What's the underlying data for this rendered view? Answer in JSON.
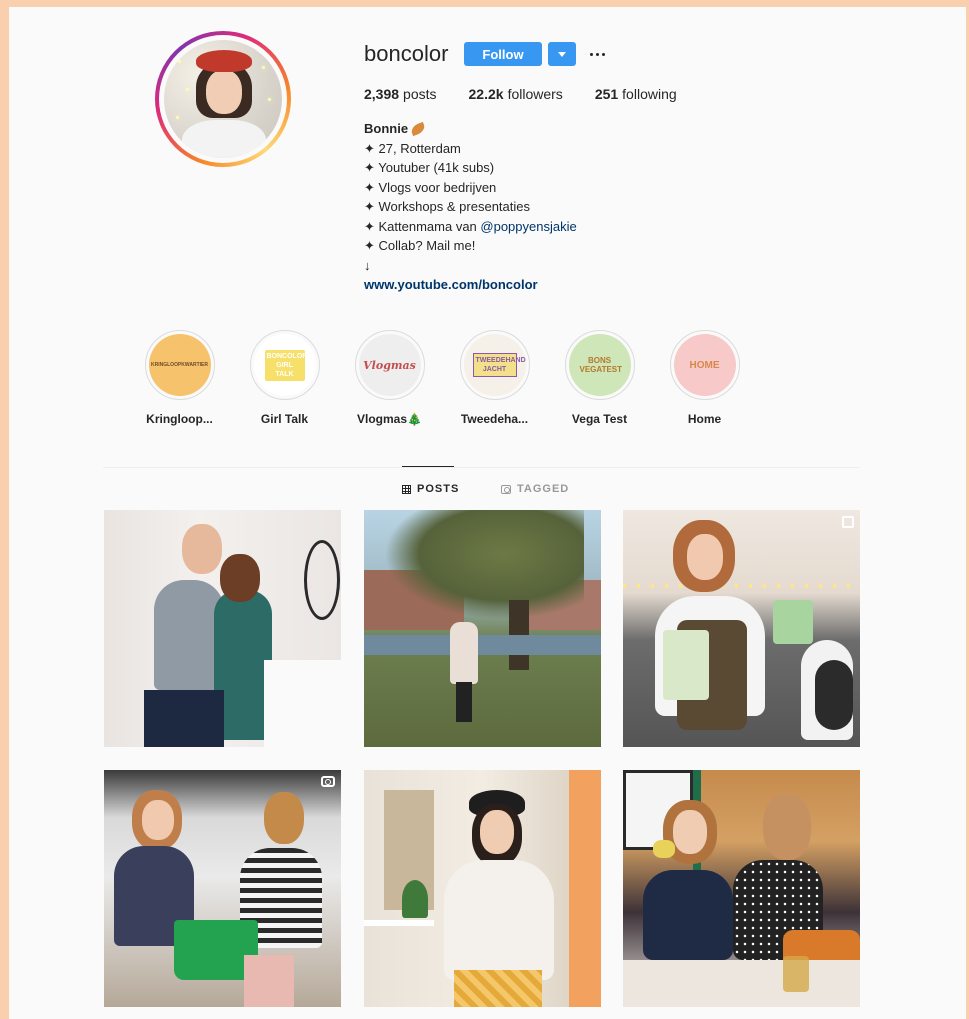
{
  "profile": {
    "username": "boncolor",
    "follow_label": "Follow",
    "stats": {
      "posts_count": "2,398",
      "posts_label": "posts",
      "followers_count": "22.2k",
      "followers_label": "followers",
      "following_count": "251",
      "following_label": "following"
    },
    "bio": {
      "name": "Bonnie",
      "lines": [
        "✦ 27, Rotterdam",
        "✦ Youtuber (41k subs)",
        "✦ Vlogs voor bedrijven",
        "✦ Workshops & presentaties"
      ],
      "kitten_prefix": "✦ Kattenmama van ",
      "kitten_mention": "@poppyensjakie",
      "collab_line": "✦ Collab? Mail me!",
      "arrow": "↓",
      "link": "www.youtube.com/boncolor"
    }
  },
  "highlights": [
    {
      "label": "Kringloop...",
      "cover_text": "KRINGLOOPKWARTIER",
      "bg": "#f6c26b",
      "fg": "#6b4a2a"
    },
    {
      "label": "Girl Talk",
      "cover_text": "BONCOLOR GIRL TALK",
      "bg": "#ffffff",
      "fg": "#e9a93b"
    },
    {
      "label": "Vlogmas🎄",
      "cover_text": "Vlogmas",
      "bg": "#eeeeee",
      "fg": "#c44d4d"
    },
    {
      "label": "Tweedeha...",
      "cover_text": "TWEEDEHANDS JACHT",
      "bg": "#f5f0e8",
      "fg": "#8a5aa8"
    },
    {
      "label": "Vega Test",
      "cover_text": "BONS VEGATEST",
      "bg": "#cfe6b9",
      "fg": "#b5792a"
    },
    {
      "label": "Home",
      "cover_text": "HOME",
      "bg": "#f7c9c9",
      "fg": "#d8884a"
    }
  ],
  "tabs": {
    "posts": "POSTS",
    "tagged": "TAGGED"
  },
  "colors": {
    "follow_blue": "#3897f0",
    "link_blue": "#003569",
    "frame_peach": "#f9cfae"
  }
}
